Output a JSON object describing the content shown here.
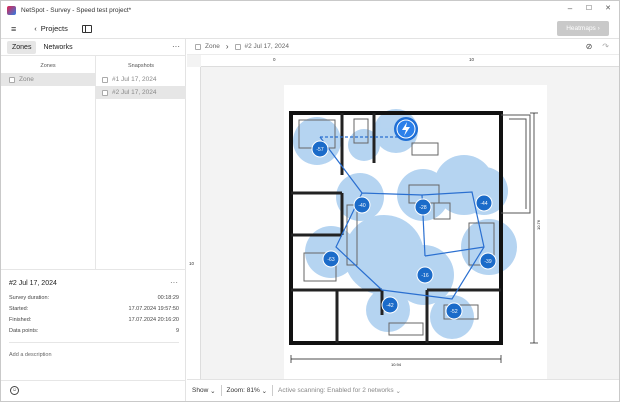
{
  "window": {
    "title": "NetSpot - Survey - Speed test project*",
    "controls": [
      "–",
      "☐",
      "✕"
    ]
  },
  "toolbar": {
    "menu_icon": "≡",
    "back_label": "Projects",
    "heatmaps_label": "Heatmaps"
  },
  "left": {
    "tabs": [
      "Zones",
      "Networks"
    ],
    "more": "···",
    "zones_header": "Zones",
    "snapshots_header": "Snapshots",
    "zone_item": "Zone",
    "snapshots": [
      "#1 Jul 17, 2024",
      "#2 Jul 17, 2024"
    ],
    "info": {
      "title": "#2 Jul 17, 2024",
      "rows": [
        {
          "label": "Survey duration:",
          "value": "00:18:29"
        },
        {
          "label": "Started:",
          "value": "17.07.2024 19:57:50"
        },
        {
          "label": "Finished:",
          "value": "17.07.2024 20:16:20"
        },
        {
          "label": "Data points:",
          "value": "9"
        }
      ],
      "add_description": "Add a description"
    }
  },
  "breadcrumb": {
    "zone": "Zone",
    "snapshot": "#2 Jul 17, 2024"
  },
  "ruler": {
    "h0": "0",
    "h10": "10",
    "v10": "10"
  },
  "plan": {
    "dim_h": "10.94",
    "dim_v": "10.76",
    "points": [
      {
        "label": "-57"
      },
      {
        "label": "-40"
      },
      {
        "label": "-28"
      },
      {
        "label": "-44"
      },
      {
        "label": "-63"
      },
      {
        "label": "-39"
      },
      {
        "label": "-16"
      },
      {
        "label": "-42"
      },
      {
        "label": "-52"
      }
    ],
    "router_icon": "router-icon"
  },
  "status": {
    "show": "Show",
    "zoom": "Zoom: 81%",
    "scanning": "Active scanning: Enabled for 2 networks"
  },
  "colors": {
    "accent": "#1f6fd6",
    "point": "#1b6bc9",
    "heat": "#a9cdef"
  }
}
